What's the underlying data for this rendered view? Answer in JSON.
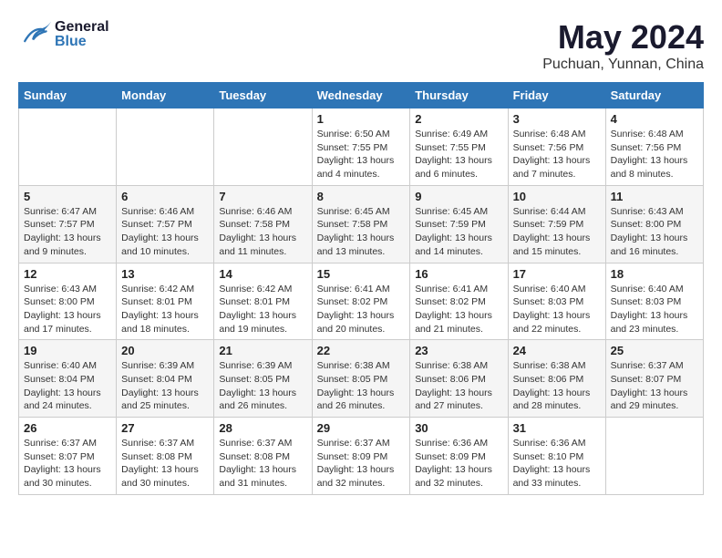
{
  "header": {
    "logo_general": "General",
    "logo_blue": "Blue",
    "month_year": "May 2024",
    "location": "Puchuan, Yunnan, China"
  },
  "weekdays": [
    "Sunday",
    "Monday",
    "Tuesday",
    "Wednesday",
    "Thursday",
    "Friday",
    "Saturday"
  ],
  "weeks": [
    [
      {
        "day": "",
        "info": ""
      },
      {
        "day": "",
        "info": ""
      },
      {
        "day": "",
        "info": ""
      },
      {
        "day": "1",
        "info": "Sunrise: 6:50 AM\nSunset: 7:55 PM\nDaylight: 13 hours\nand 4 minutes."
      },
      {
        "day": "2",
        "info": "Sunrise: 6:49 AM\nSunset: 7:55 PM\nDaylight: 13 hours\nand 6 minutes."
      },
      {
        "day": "3",
        "info": "Sunrise: 6:48 AM\nSunset: 7:56 PM\nDaylight: 13 hours\nand 7 minutes."
      },
      {
        "day": "4",
        "info": "Sunrise: 6:48 AM\nSunset: 7:56 PM\nDaylight: 13 hours\nand 8 minutes."
      }
    ],
    [
      {
        "day": "5",
        "info": "Sunrise: 6:47 AM\nSunset: 7:57 PM\nDaylight: 13 hours\nand 9 minutes."
      },
      {
        "day": "6",
        "info": "Sunrise: 6:46 AM\nSunset: 7:57 PM\nDaylight: 13 hours\nand 10 minutes."
      },
      {
        "day": "7",
        "info": "Sunrise: 6:46 AM\nSunset: 7:58 PM\nDaylight: 13 hours\nand 11 minutes."
      },
      {
        "day": "8",
        "info": "Sunrise: 6:45 AM\nSunset: 7:58 PM\nDaylight: 13 hours\nand 13 minutes."
      },
      {
        "day": "9",
        "info": "Sunrise: 6:45 AM\nSunset: 7:59 PM\nDaylight: 13 hours\nand 14 minutes."
      },
      {
        "day": "10",
        "info": "Sunrise: 6:44 AM\nSunset: 7:59 PM\nDaylight: 13 hours\nand 15 minutes."
      },
      {
        "day": "11",
        "info": "Sunrise: 6:43 AM\nSunset: 8:00 PM\nDaylight: 13 hours\nand 16 minutes."
      }
    ],
    [
      {
        "day": "12",
        "info": "Sunrise: 6:43 AM\nSunset: 8:00 PM\nDaylight: 13 hours\nand 17 minutes."
      },
      {
        "day": "13",
        "info": "Sunrise: 6:42 AM\nSunset: 8:01 PM\nDaylight: 13 hours\nand 18 minutes."
      },
      {
        "day": "14",
        "info": "Sunrise: 6:42 AM\nSunset: 8:01 PM\nDaylight: 13 hours\nand 19 minutes."
      },
      {
        "day": "15",
        "info": "Sunrise: 6:41 AM\nSunset: 8:02 PM\nDaylight: 13 hours\nand 20 minutes."
      },
      {
        "day": "16",
        "info": "Sunrise: 6:41 AM\nSunset: 8:02 PM\nDaylight: 13 hours\nand 21 minutes."
      },
      {
        "day": "17",
        "info": "Sunrise: 6:40 AM\nSunset: 8:03 PM\nDaylight: 13 hours\nand 22 minutes."
      },
      {
        "day": "18",
        "info": "Sunrise: 6:40 AM\nSunset: 8:03 PM\nDaylight: 13 hours\nand 23 minutes."
      }
    ],
    [
      {
        "day": "19",
        "info": "Sunrise: 6:40 AM\nSunset: 8:04 PM\nDaylight: 13 hours\nand 24 minutes."
      },
      {
        "day": "20",
        "info": "Sunrise: 6:39 AM\nSunset: 8:04 PM\nDaylight: 13 hours\nand 25 minutes."
      },
      {
        "day": "21",
        "info": "Sunrise: 6:39 AM\nSunset: 8:05 PM\nDaylight: 13 hours\nand 26 minutes."
      },
      {
        "day": "22",
        "info": "Sunrise: 6:38 AM\nSunset: 8:05 PM\nDaylight: 13 hours\nand 26 minutes."
      },
      {
        "day": "23",
        "info": "Sunrise: 6:38 AM\nSunset: 8:06 PM\nDaylight: 13 hours\nand 27 minutes."
      },
      {
        "day": "24",
        "info": "Sunrise: 6:38 AM\nSunset: 8:06 PM\nDaylight: 13 hours\nand 28 minutes."
      },
      {
        "day": "25",
        "info": "Sunrise: 6:37 AM\nSunset: 8:07 PM\nDaylight: 13 hours\nand 29 minutes."
      }
    ],
    [
      {
        "day": "26",
        "info": "Sunrise: 6:37 AM\nSunset: 8:07 PM\nDaylight: 13 hours\nand 30 minutes."
      },
      {
        "day": "27",
        "info": "Sunrise: 6:37 AM\nSunset: 8:08 PM\nDaylight: 13 hours\nand 30 minutes."
      },
      {
        "day": "28",
        "info": "Sunrise: 6:37 AM\nSunset: 8:08 PM\nDaylight: 13 hours\nand 31 minutes."
      },
      {
        "day": "29",
        "info": "Sunrise: 6:37 AM\nSunset: 8:09 PM\nDaylight: 13 hours\nand 32 minutes."
      },
      {
        "day": "30",
        "info": "Sunrise: 6:36 AM\nSunset: 8:09 PM\nDaylight: 13 hours\nand 32 minutes."
      },
      {
        "day": "31",
        "info": "Sunrise: 6:36 AM\nSunset: 8:10 PM\nDaylight: 13 hours\nand 33 minutes."
      },
      {
        "day": "",
        "info": ""
      }
    ]
  ]
}
